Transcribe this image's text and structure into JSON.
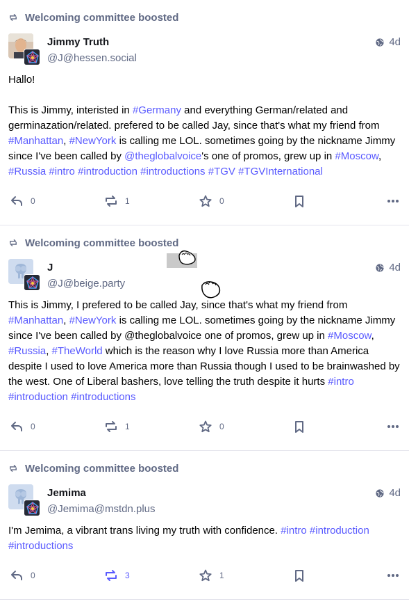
{
  "posts": [
    {
      "boost_text": "Welcoming committee boosted",
      "display_name": "Jimmy Truth",
      "handle": "@J@hessen.social",
      "time": "4d",
      "avatar": "photo-avatar",
      "content": [
        [
          {
            "t": "Hallo!"
          }
        ],
        [
          {
            "t": "This is Jimmy, interisted in "
          },
          {
            "t": "#Germany",
            "k": "tag"
          },
          {
            "t": " and everything German/related and germinazation/related. prefered to be called Jay, since that's what my friend from "
          },
          {
            "t": "#Manhattan",
            "k": "tag"
          },
          {
            "t": ", "
          },
          {
            "t": "#NewYork",
            "k": "tag"
          },
          {
            "t": " is calling me LOL. sometimes going by the nickname Jimmy since I've been called by "
          },
          {
            "t": "@theglobalvoice",
            "k": "mention"
          },
          {
            "t": "'s one of promos, grew up in "
          },
          {
            "t": "#Moscow",
            "k": "tag"
          },
          {
            "t": ", "
          },
          {
            "t": "#Russia",
            "k": "tag"
          },
          {
            "t": " "
          },
          {
            "t": "#intro",
            "k": "tag"
          },
          {
            "t": " "
          },
          {
            "t": "#introduction",
            "k": "tag"
          },
          {
            "t": " "
          },
          {
            "t": "#introductions",
            "k": "tag"
          },
          {
            "t": " "
          },
          {
            "t": "#TGV",
            "k": "tag"
          },
          {
            "t": " "
          },
          {
            "t": "#TGVInternational",
            "k": "tag"
          }
        ]
      ],
      "replies": "0",
      "boosts": "1",
      "favs": "0",
      "boosted_by_me": false
    },
    {
      "boost_text": "Welcoming committee boosted",
      "display_name": "J",
      "handle": "@J@beige.party",
      "time": "4d",
      "avatar": "elephant-avatar",
      "content": [
        [
          {
            "t": "This is Jimmy, I prefered to be called Jay, since that's what my friend from "
          },
          {
            "t": "#Manhattan",
            "k": "tag"
          },
          {
            "t": ", "
          },
          {
            "t": "#NewYork",
            "k": "tag"
          },
          {
            "t": " is calling me LOL. sometimes going by the nickname Jimmy since I've been called by @theglobalvoice one of promos, grew up in "
          },
          {
            "t": "#Moscow",
            "k": "tag"
          },
          {
            "t": ", "
          },
          {
            "t": "#Russia",
            "k": "tag"
          },
          {
            "t": ", "
          },
          {
            "t": "#TheWorld",
            "k": "tag"
          },
          {
            "t": " which is the reason why I love Russia more than America despite I used to love America more than Russia though I used to be brainwashed by the west. One of Liberal bashers, love telling the truth despite it hurts "
          },
          {
            "t": "#intro",
            "k": "tag"
          },
          {
            "t": " "
          },
          {
            "t": "#introduction",
            "k": "tag"
          },
          {
            "t": " "
          },
          {
            "t": "#introductions",
            "k": "tag"
          }
        ]
      ],
      "replies": "0",
      "boosts": "1",
      "favs": "0",
      "boosted_by_me": false
    },
    {
      "boost_text": "Welcoming committee boosted",
      "display_name": "Jemima",
      "handle": "@Jemima@mstdn.plus",
      "time": "4d",
      "avatar": "elephant-avatar",
      "content": [
        [
          {
            "t": "I'm Jemima, a vibrant trans living my truth with confidence. "
          },
          {
            "t": "#intro",
            "k": "tag"
          },
          {
            "t": " "
          },
          {
            "t": "#introduction",
            "k": "tag"
          },
          {
            "t": " "
          },
          {
            "t": "#introductions",
            "k": "tag"
          }
        ]
      ],
      "replies": "0",
      "boosts": "3",
      "favs": "1",
      "boosted_by_me": true
    }
  ],
  "icons": {
    "boost": "boost-icon",
    "visibility": "globe-icon",
    "reply": "reply-icon",
    "favourite": "star-icon",
    "bookmark": "bookmark-icon",
    "more": "more-icon"
  },
  "colors": {
    "accent": "#595aff",
    "muted": "#606984"
  }
}
